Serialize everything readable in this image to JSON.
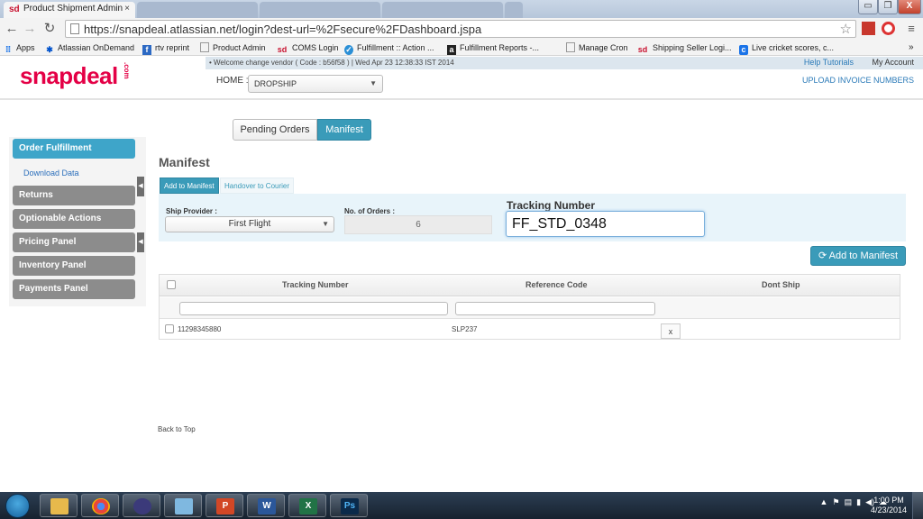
{
  "browser": {
    "active_tab": {
      "favicon": "sd",
      "title": "Product Shipment Admin",
      "close": "×"
    },
    "url": "https://snapdeal.atlassian.net/login?dest-url=%2Fsecure%2FDashboard.jspa",
    "window_controls": {
      "minimize": "▭",
      "restore": "❐",
      "close": "X"
    }
  },
  "bookmarks": [
    {
      "label": "Apps",
      "icon": "apps-grid-icon"
    },
    {
      "label": "Atlassian OnDemand",
      "icon": "atlassian-icon"
    },
    {
      "label": "rtv reprint",
      "icon": "bookmark-icon"
    },
    {
      "label": "Product Admin",
      "icon": "page-icon"
    },
    {
      "label": "COMS Login",
      "icon": "sd-icon"
    },
    {
      "label": "Fulfillment :: Action ...",
      "icon": "check-circle-icon"
    },
    {
      "label": "Fulfillment Reports -...",
      "icon": "a-icon"
    },
    {
      "label": "Manage Cron",
      "icon": "page-icon"
    },
    {
      "label": "Shipping Seller Logi...",
      "icon": "sd-icon"
    },
    {
      "label": "Live cricket scores, c...",
      "icon": "c-icon"
    },
    {
      "label": "»",
      "icon": ""
    }
  ],
  "header": {
    "logo": "snapdeal",
    "logo_suffix": ".com",
    "welcome": "• Welcome change vendor ( Code : b56f58 ) | Wed Apr 23 12:38:33 IST 2014",
    "help_link": "Help Tutorials",
    "account_link": "My Account",
    "home_label": "HOME :",
    "channel_value": "DROPSHIP",
    "upload_link": "UPLOAD INVOICE NUMBERS"
  },
  "sidebar": {
    "items": [
      {
        "label": "Order Fulfillment",
        "active": true
      },
      {
        "label": "Returns",
        "active": false
      },
      {
        "label": "Optionable Actions",
        "active": false
      },
      {
        "label": "Pricing Panel",
        "active": false
      },
      {
        "label": "Inventory Panel",
        "active": false
      },
      {
        "label": "Payments Panel",
        "active": false
      }
    ],
    "sub_item": "Download Data"
  },
  "main": {
    "tabs": {
      "pending": "Pending Orders",
      "manifest": "Manifest"
    },
    "title": "Manifest",
    "subtabs": {
      "add": "Add to Manifest",
      "handover": "Handover to Courier"
    },
    "form": {
      "ship_provider_label": "Ship Provider :",
      "ship_provider_value": "First Flight",
      "orders_label": "No. of Orders :",
      "orders_value": "6",
      "tracking_label": "Tracking Number",
      "tracking_value": "FF_STD_0348"
    },
    "add_button": "Add to Manifest",
    "table": {
      "columns": [
        "Tracking Number",
        "Reference Code",
        "Dont Ship"
      ],
      "rows": [
        {
          "tracking": "11298345880",
          "reference": "SLP237",
          "dont_ship": "x"
        }
      ]
    },
    "back_to_top": "Back to Top"
  },
  "taskbar": {
    "apps": [
      {
        "name": "file-explorer",
        "glyph": ""
      },
      {
        "name": "chrome",
        "glyph": ""
      },
      {
        "name": "eclipse",
        "glyph": ""
      },
      {
        "name": "notepad",
        "glyph": ""
      },
      {
        "name": "powerpoint",
        "glyph": "P"
      },
      {
        "name": "word",
        "glyph": "W"
      },
      {
        "name": "excel",
        "glyph": "X"
      },
      {
        "name": "photoshop",
        "glyph": "Ps"
      }
    ],
    "clock_time": "1:00 PM",
    "clock_date": "4/23/2014"
  },
  "colors": {
    "brand": "#e40046",
    "accent": "#3a9bb9",
    "sidebar_active": "#3ea5c9"
  }
}
